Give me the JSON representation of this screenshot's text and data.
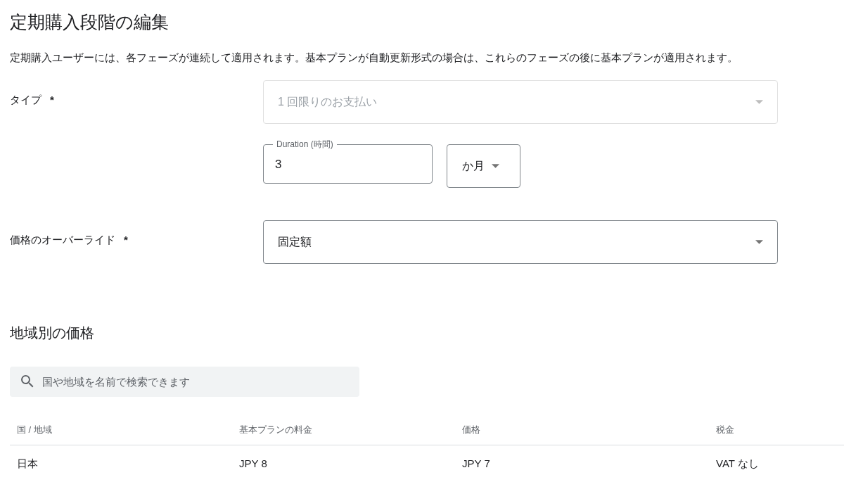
{
  "title": "定期購入段階の編集",
  "description": "定期購入ユーザーには、各フェーズが連続して適用されます。基本プランが自動更新形式の場合は、これらのフェーズの後に基本プランが適用されます。",
  "type_field": {
    "label": "タイプ",
    "required_mark": "*",
    "value": "1 回限りのお支払い",
    "disabled": true
  },
  "duration": {
    "label": "Duration (時間)",
    "value": "3"
  },
  "duration_unit": {
    "value": "か月",
    "disabled": false
  },
  "price_override": {
    "label": "価格のオーバーライド",
    "required_mark": "*",
    "value": "固定額",
    "disabled": false
  },
  "regional_prices": {
    "heading": "地域別の価格",
    "search": {
      "placeholder": "国や地域を名前で検索できます"
    },
    "table": {
      "columns": [
        "国 / 地域",
        "基本プランの料金",
        "価格",
        "税金"
      ],
      "rows": [
        [
          "日本",
          "JPY 8",
          "JPY 7",
          "VAT なし"
        ]
      ]
    }
  }
}
